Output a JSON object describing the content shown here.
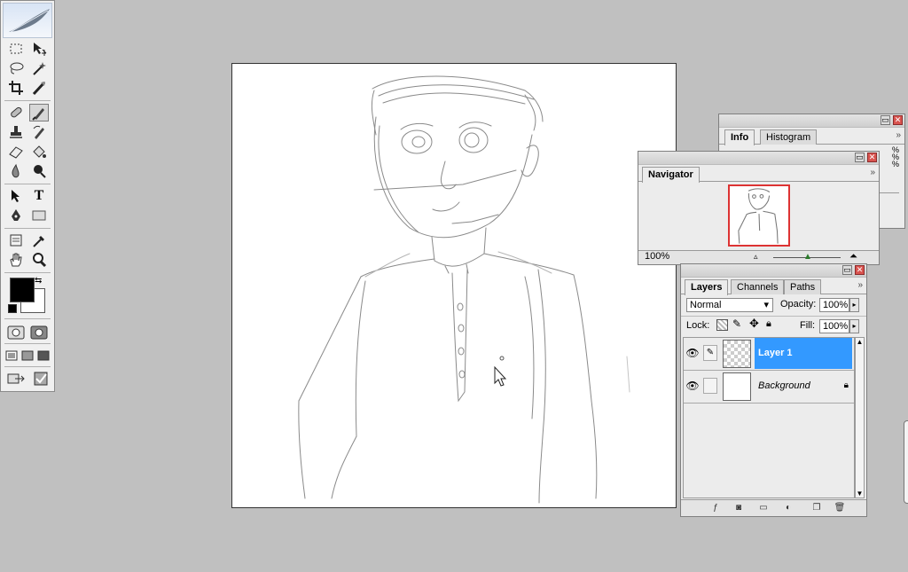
{
  "tools": [
    {
      "name": "rectangular-marquee-icon"
    },
    {
      "name": "move-icon"
    },
    {
      "name": "lasso-icon"
    },
    {
      "name": "magic-wand-icon"
    },
    {
      "name": "crop-icon"
    },
    {
      "name": "slice-icon"
    },
    {
      "name": "healing-brush-icon"
    },
    {
      "name": "brush-icon",
      "active": true
    },
    {
      "name": "clone-stamp-icon"
    },
    {
      "name": "history-brush-icon"
    },
    {
      "name": "eraser-icon"
    },
    {
      "name": "paint-bucket-icon"
    },
    {
      "name": "blur-icon"
    },
    {
      "name": "dodge-icon"
    },
    {
      "name": "path-selection-icon"
    },
    {
      "name": "type-icon"
    },
    {
      "name": "pen-icon"
    },
    {
      "name": "rectangle-shape-icon"
    },
    {
      "name": "notes-icon"
    },
    {
      "name": "eyedropper-icon"
    },
    {
      "name": "hand-icon"
    },
    {
      "name": "zoom-icon"
    }
  ],
  "colors": {
    "foreground": "#000000",
    "background": "#ffffff",
    "accent_selected": "#3399ff"
  },
  "type_tool_glyph": "T",
  "info_palette": {
    "tabs": [
      "Info",
      "Histogram"
    ],
    "active_tab": "Info",
    "right_marks": [
      "%",
      "%",
      "%"
    ]
  },
  "navigator": {
    "tab": "Navigator",
    "zoom": "100%"
  },
  "layers": {
    "tabs": [
      "Layers",
      "Channels",
      "Paths"
    ],
    "active_tab": "Layers",
    "blend_mode": "Normal",
    "opacity_label": "Opacity:",
    "opacity_value": "100%",
    "lock_label": "Lock:",
    "fill_label": "Fill:",
    "fill_value": "100%",
    "items": [
      {
        "name": "Layer 1",
        "selected": true,
        "visible": true
      },
      {
        "name": "Background",
        "selected": false,
        "visible": true,
        "locked": true
      }
    ]
  },
  "palette_menu_glyph": "»"
}
